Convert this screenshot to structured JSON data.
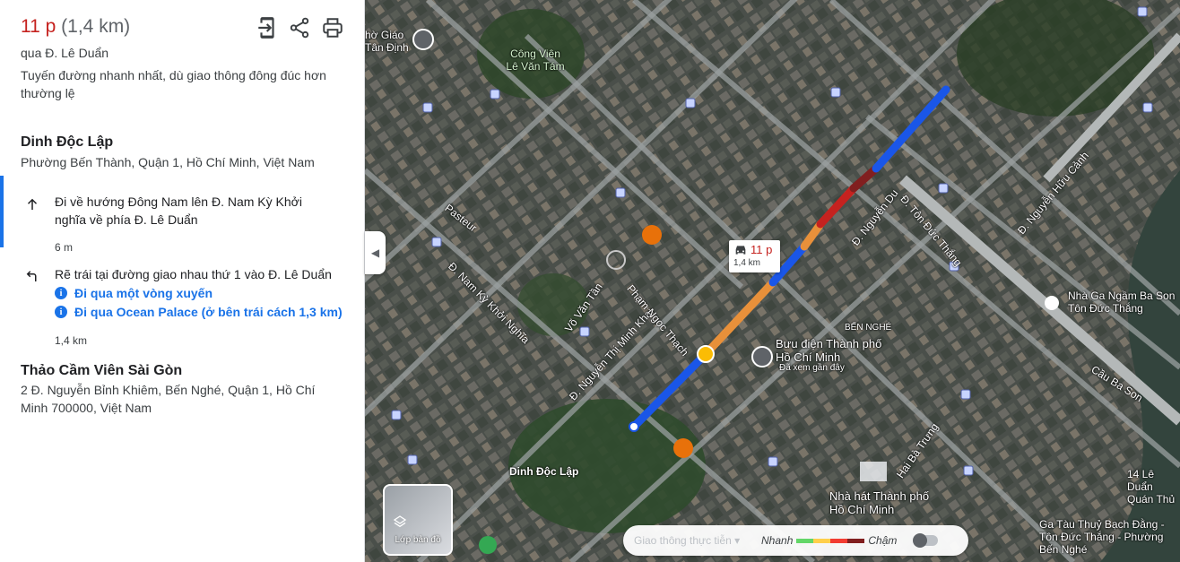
{
  "summary": {
    "time": "11 p",
    "distance": "(1,4 km)",
    "via": "qua Đ. Lê Duẩn",
    "description": "Tuyến đường nhanh nhất, dù giao thông đông đúc hơn thường lệ"
  },
  "icons": {
    "send_to_phone": "send-to-phone-icon",
    "share": "share-icon",
    "print": "print-icon"
  },
  "origin": {
    "name": "Dinh Độc Lập",
    "address": "Phường Bến Thành, Quận 1, Hồ Chí Minh, Việt Nam"
  },
  "steps": [
    {
      "icon": "arrow-up-icon",
      "text": "Đi về hướng Đông Nam lên Đ. Nam Kỳ Khởi nghĩa về phía Đ. Lê Duẩn",
      "distance": "6 m"
    },
    {
      "icon": "turn-left-icon",
      "text": "Rẽ trái tại đường giao nhau thứ 1 vào Đ. Lê Duẩn",
      "notes": [
        "Đi qua một vòng xuyến",
        "Đi qua Ocean Palace (ở bên trái cách 1,3 km)"
      ],
      "distance": "1,4 km"
    }
  ],
  "destination": {
    "name": "Thảo Cầm Viên Sài Gòn",
    "address": "2 Đ. Nguyễn Bỉnh Khiêm, Bến Nghé, Quận 1, Hồ Chí Minh 700000, Việt Nam"
  },
  "map": {
    "route_card": {
      "time": "11 p",
      "distance": "1,4 km"
    },
    "labels": {
      "cong_vien": "Công Viên Lê Văn Tám",
      "dinh_doc_lap": "Dinh Độc Lập",
      "buu_dien": "Bưu điện Thành phố Hồ Chí Minh",
      "buu_dien_sub": "Đã xem gần đây",
      "nha_hat": "Nhà hát Thành phố Hồ Chí Minh",
      "ben_nghe": "BẾN NGHÉ",
      "nha_ga": "Nhà Ga Ngầm Ba Son Tôn Đức Thắng",
      "ga_tau": "Ga Tàu Thuỷ Bạch Đằng - Tôn Đức Thắng - Phường Bến Nghé",
      "cau_ba_son": "Cầu Ba Son",
      "ton_duc_thang": "Đ. Tôn Đức Thắng",
      "nguyen_huu_canh": "Đ. Nguyễn Hữu Cảnh",
      "pasteur": "Pasteur",
      "hai_ba_trung": "Hai Bà Trưng",
      "nguyen_thi_minh_khai": "Đ. Nguyễn Thị Minh Khai",
      "pham_ngoc_thach": "Phạm Ngọc Thạch",
      "vo_van_tan": "Võ Văn Tần",
      "nam_ky_khoi_nghia": "Đ. Nam Kỳ Khởi Nghĩa",
      "nguyen_du": "Đ. Nguyễn Du",
      "top_left": "hờ Giáo Tân Định",
      "quan_thu": "14 Lê Duẩn Quán Thủ"
    },
    "layers_label": "Lớp bản đồ",
    "traffic": {
      "select_placeholder": "Giao thông thực tiễn",
      "fast": "Nhanh",
      "slow": "Chậm",
      "colors": [
        "#63d668",
        "#ffcf4a",
        "#f23c32",
        "#811f1f"
      ]
    },
    "route_colors": {
      "normal": "#1a56e8",
      "slow": "#e8903a",
      "jam": "#c5221f"
    }
  }
}
